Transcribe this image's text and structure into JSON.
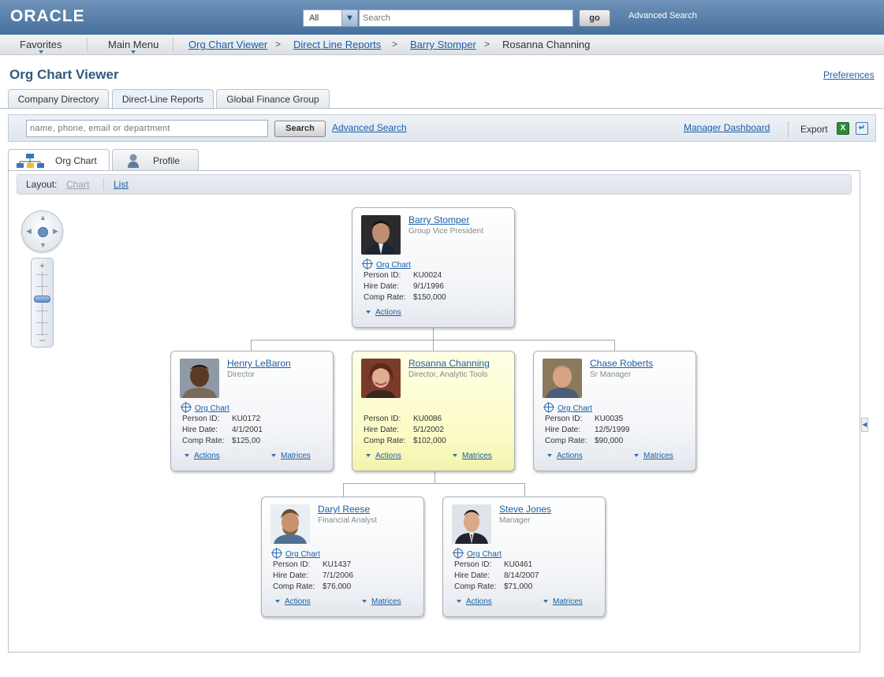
{
  "header": {
    "logo": "ORACLE",
    "scope_value": "All",
    "search_placeholder": "Search",
    "go_label": "go",
    "advanced_search": "Advanced Search"
  },
  "nav": {
    "favorites": "Favorites",
    "main_menu": "Main Menu",
    "breadcrumbs": [
      "Org Chart Viewer",
      "Direct Line Reports",
      "Barry Stomper",
      "Rosanna Channing"
    ],
    "crumb_separator": ">"
  },
  "page": {
    "title": "Org Chart Viewer",
    "preferences": "Preferences"
  },
  "tabs": [
    "Company Directory",
    "Direct-Line Reports",
    "Global Finance Group"
  ],
  "searchbar": {
    "placeholder": "name, phone, email or department",
    "search_label": "Search",
    "advanced_search": "Advanced Search",
    "manager_dashboard": "Manager Dashboard",
    "export_label": "Export"
  },
  "subtabs": {
    "org_chart": "Org Chart",
    "profile": "Profile"
  },
  "layout_bar": {
    "label": "Layout:",
    "chart": "Chart",
    "list": "List"
  },
  "card_labels": {
    "org_chart": "Org Chart",
    "person_id": "Person ID:",
    "hire_date": "Hire Date:",
    "comp_rate": "Comp Rate:",
    "actions": "Actions",
    "matrices": "Matrices"
  },
  "people": [
    {
      "name": "Barry Stomper",
      "title": "Group Vice President",
      "person_id": "KU0024",
      "hire_date": "9/1/1996",
      "comp_rate": "$150,000"
    },
    {
      "name": "Henry LeBaron",
      "title": "Director",
      "person_id": "KU0172",
      "hire_date": "4/1/2001",
      "comp_rate": "$125,00"
    },
    {
      "name": "Rosanna Channing",
      "title": "Director, Analytic Tools",
      "person_id": "KU0086",
      "hire_date": "5/1/2002",
      "comp_rate": "$102,000"
    },
    {
      "name": "Chase Roberts",
      "title": "Sr Manager",
      "person_id": "KU0035",
      "hire_date": "12/5/1999",
      "comp_rate": "$90,000"
    },
    {
      "name": "Daryl Reese",
      "title": "Financial Analyst",
      "person_id": "KU1437",
      "hire_date": "7/1/2006",
      "comp_rate": "$76,000"
    },
    {
      "name": "Steve Jones",
      "title": "Manager",
      "person_id": "KU0461",
      "hire_date": "8/14/2007",
      "comp_rate": "$71,000"
    }
  ],
  "colors": {
    "header_top": "#6f93b9",
    "header_bottom": "#46709c",
    "link": "#1a5fa8",
    "title": "#305980",
    "highlight_card": "#fbfbc6"
  }
}
